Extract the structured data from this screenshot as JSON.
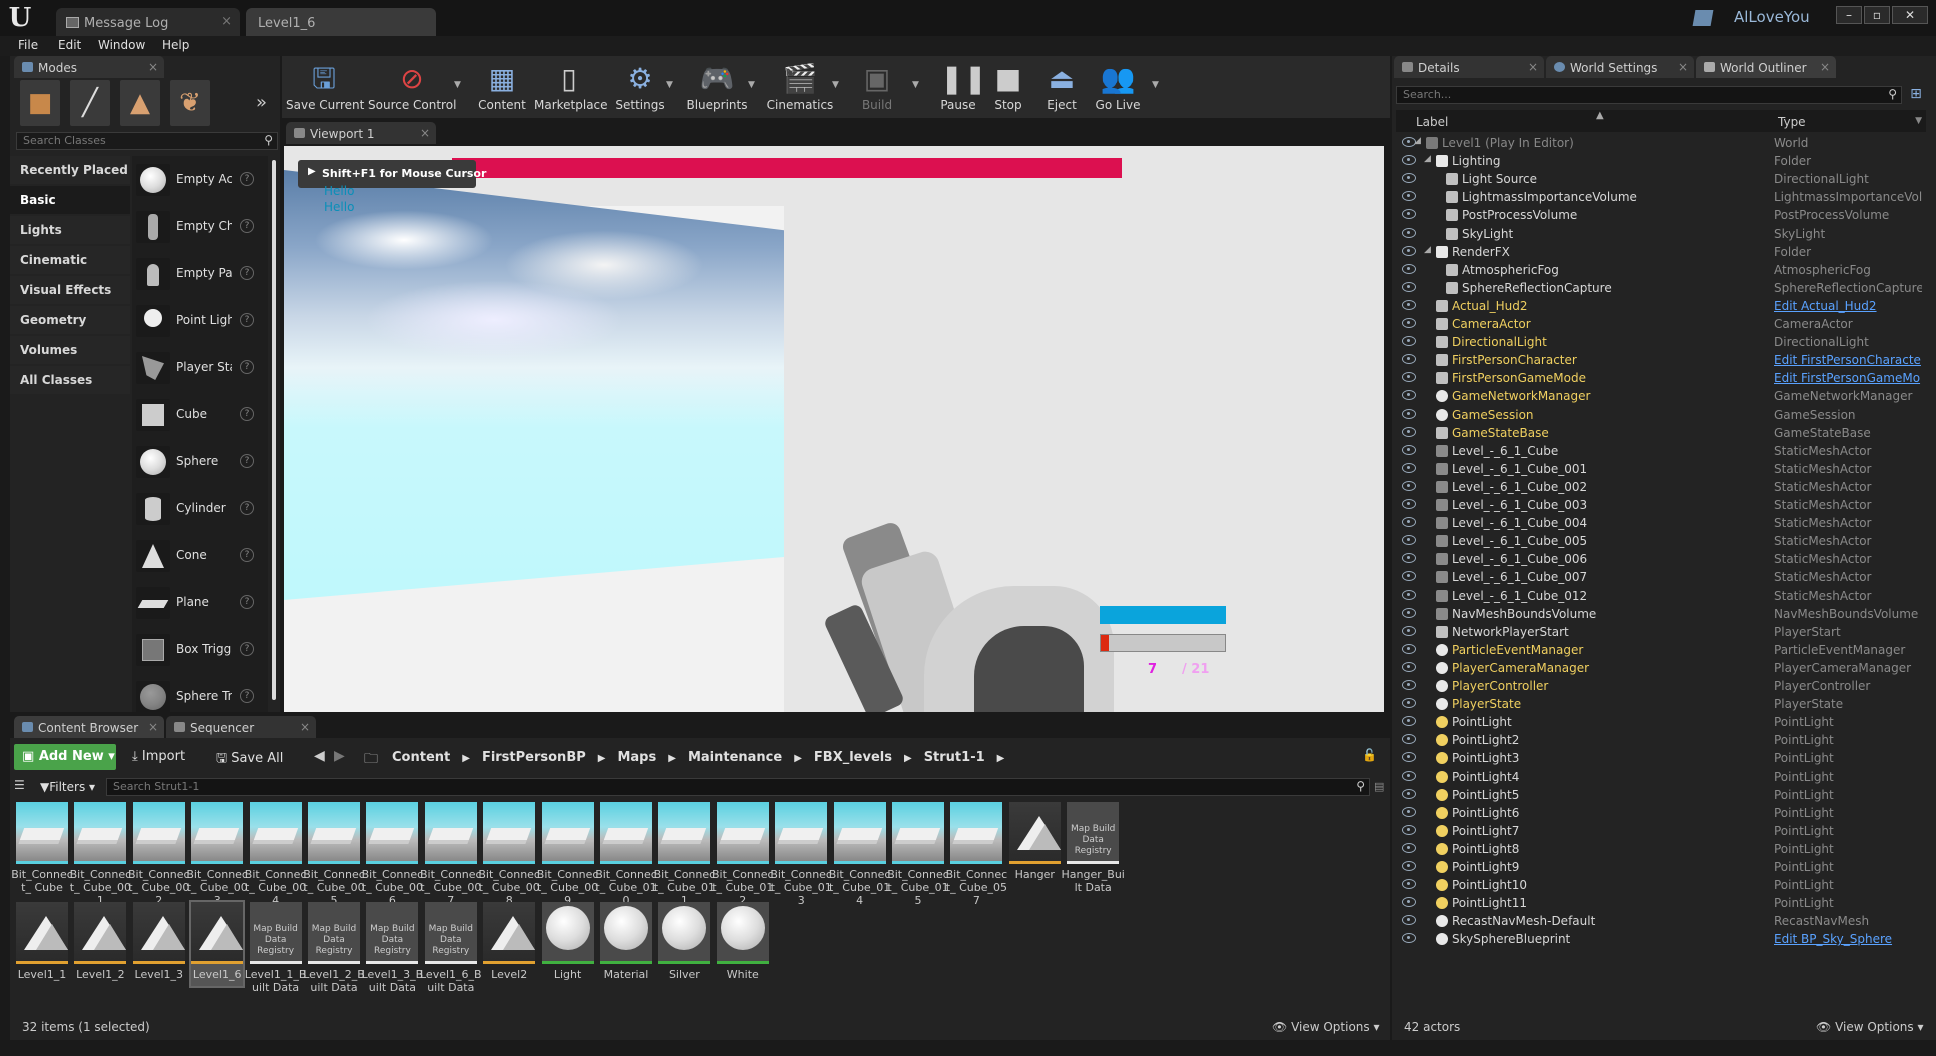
{
  "window": {
    "tabs": [
      {
        "label": "Message Log"
      },
      {
        "label": "Level1_6"
      }
    ],
    "user": "AlLoveYou"
  },
  "menu": [
    "File",
    "Edit",
    "Window",
    "Help"
  ],
  "modes": {
    "tab_label": "Modes",
    "search_placeholder": "Search Classes",
    "categories": [
      "Recently Placed",
      "Basic",
      "Lights",
      "Cinematic",
      "Visual Effects",
      "Geometry",
      "Volumes",
      "All Classes"
    ],
    "items": [
      "Empty Act",
      "Empty Cha",
      "Empty Pav",
      "Point Ligh",
      "Player Sta",
      "Cube",
      "Sphere",
      "Cylinder",
      "Cone",
      "Plane",
      "Box Trigg",
      "Sphere Tr"
    ]
  },
  "toolbar": {
    "buttons": [
      "Save Current",
      "Source Control",
      "Content",
      "Marketplace",
      "Settings",
      "Blueprints",
      "Cinematics",
      "Build",
      "Pause",
      "Stop",
      "Eject",
      "Go Live"
    ]
  },
  "viewport": {
    "tab_label": "Viewport 1",
    "tooltip": "Shift+F1 for Mouse Cursor",
    "hello_lines": [
      "Hello",
      "Hello"
    ],
    "ammo": "7",
    "ammo_total": "/ 21"
  },
  "details_panel": {
    "tabs": [
      "Details",
      "World Settings",
      "World Outliner"
    ],
    "search_placeholder": "Search...",
    "columns": {
      "label": "Label",
      "type": "Type"
    },
    "rows": [
      {
        "label": "Level1 (Play In Editor)",
        "type": "World"
      },
      {
        "label": "Lighting",
        "type": "Folder"
      },
      {
        "label": "Light Source",
        "type": "DirectionalLight"
      },
      {
        "label": "LightmassImportanceVolume",
        "type": "LightmassImportanceVolume"
      },
      {
        "label": "PostProcessVolume",
        "type": "PostProcessVolume"
      },
      {
        "label": "SkyLight",
        "type": "SkyLight"
      },
      {
        "label": "RenderFX",
        "type": "Folder"
      },
      {
        "label": "AtmosphericFog",
        "type": "AtmosphericFog"
      },
      {
        "label": "SphereReflectionCapture",
        "type": "SphereReflectionCapture"
      },
      {
        "label": "Actual_Hud2",
        "type": "Edit Actual_Hud2"
      },
      {
        "label": "CameraActor",
        "type": "CameraActor"
      },
      {
        "label": "DirectionalLight",
        "type": "DirectionalLight"
      },
      {
        "label": "FirstPersonCharacter",
        "type": "Edit FirstPersonCharacte"
      },
      {
        "label": "FirstPersonGameMode",
        "type": "Edit FirstPersonGameMo"
      },
      {
        "label": "GameNetworkManager",
        "type": "GameNetworkManager"
      },
      {
        "label": "GameSession",
        "type": "GameSession"
      },
      {
        "label": "GameStateBase",
        "type": "GameStateBase"
      },
      {
        "label": "Level_-_6_1_Cube",
        "type": "StaticMeshActor"
      },
      {
        "label": "Level_-_6_1_Cube_001",
        "type": "StaticMeshActor"
      },
      {
        "label": "Level_-_6_1_Cube_002",
        "type": "StaticMeshActor"
      },
      {
        "label": "Level_-_6_1_Cube_003",
        "type": "StaticMeshActor"
      },
      {
        "label": "Level_-_6_1_Cube_004",
        "type": "StaticMeshActor"
      },
      {
        "label": "Level_-_6_1_Cube_005",
        "type": "StaticMeshActor"
      },
      {
        "label": "Level_-_6_1_Cube_006",
        "type": "StaticMeshActor"
      },
      {
        "label": "Level_-_6_1_Cube_007",
        "type": "StaticMeshActor"
      },
      {
        "label": "Level_-_6_1_Cube_012",
        "type": "StaticMeshActor"
      },
      {
        "label": "NavMeshBoundsVolume",
        "type": "NavMeshBoundsVolume"
      },
      {
        "label": "NetworkPlayerStart",
        "type": "PlayerStart"
      },
      {
        "label": "ParticleEventManager",
        "type": "ParticleEventManager"
      },
      {
        "label": "PlayerCameraManager",
        "type": "PlayerCameraManager"
      },
      {
        "label": "PlayerController",
        "type": "PlayerController"
      },
      {
        "label": "PlayerState",
        "type": "PlayerState"
      },
      {
        "label": "PointLight",
        "type": "PointLight"
      },
      {
        "label": "PointLight2",
        "type": "PointLight"
      },
      {
        "label": "PointLight3",
        "type": "PointLight"
      },
      {
        "label": "PointLight4",
        "type": "PointLight"
      },
      {
        "label": "PointLight5",
        "type": "PointLight"
      },
      {
        "label": "PointLight6",
        "type": "PointLight"
      },
      {
        "label": "PointLight7",
        "type": "PointLight"
      },
      {
        "label": "PointLight8",
        "type": "PointLight"
      },
      {
        "label": "PointLight9",
        "type": "PointLight"
      },
      {
        "label": "PointLight10",
        "type": "PointLight"
      },
      {
        "label": "PointLight11",
        "type": "PointLight"
      },
      {
        "label": "RecastNavMesh-Default",
        "type": "RecastNavMesh"
      },
      {
        "label": "SkySphereBlueprint",
        "type": "Edit BP_Sky_Sphere"
      }
    ],
    "actor_count": "42 actors",
    "view_options": "View Options"
  },
  "content_browser": {
    "tabs": [
      "Content Browser",
      "Sequencer"
    ],
    "add_new": "Add New",
    "import": "Import",
    "save_all": "Save All",
    "breadcrumb": [
      "Content",
      "FirstPersonBP",
      "Maps",
      "Maintenance",
      "FBX_levels",
      "Strut1-1"
    ],
    "filters": "Filters",
    "search_placeholder": "Search Strut1-1",
    "assets_row1": [
      "Bit_Connect_ Cube",
      "Bit_Connect_ Cube_001",
      "Bit_Connect_ Cube_002",
      "Bit_Connect_ Cube_003",
      "Bit_Connect_ Cube_004",
      "Bit_Connect_ Cube_005",
      "Bit_Connect_ Cube_006",
      "Bit_Connect_ Cube_007",
      "Bit_Connect_ Cube_008",
      "Bit_Connect_ Cube_009",
      "Bit_Connect_ Cube_010",
      "Bit_Connect_ Cube_011",
      "Bit_Connect_ Cube_012",
      "Bit_Connect_ Cube_013",
      "Bit_Connect_ Cube_014",
      "Bit_Connect_ Cube_015",
      "Bit_Connect_ Cube_057",
      "Hanger",
      "Hanger_Built Data"
    ],
    "assets_row2": [
      "Level1_1",
      "Level1_2",
      "Level1_3",
      "Level1_6",
      "Level1_1_Built Data",
      "Level1_2_Built Data",
      "Level1_3_Built Data",
      "Level1_6_Built Data",
      "Level2",
      "Light",
      "Material",
      "Silver",
      "White"
    ],
    "map_build_label": "Map Build Data Registry",
    "status": "32 items (1 selected)",
    "view_options": "View Options"
  }
}
